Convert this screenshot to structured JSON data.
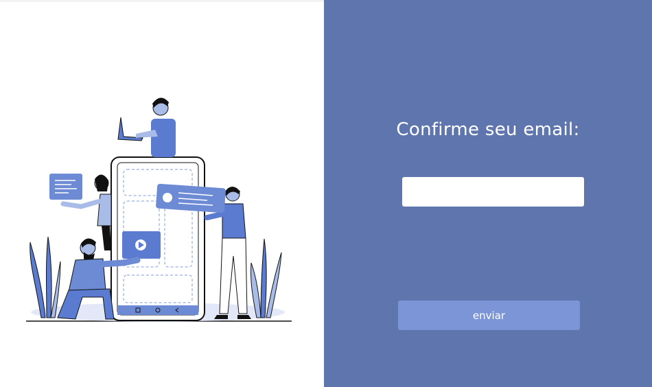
{
  "form": {
    "title": "Confirme seu email:",
    "email_value": "",
    "email_placeholder": "",
    "submit_label": "enviar"
  },
  "illustration": {
    "subject": "people-with-smartphone-illustration",
    "icons": [
      "laptop-icon",
      "message-card-icon",
      "video-play-icon",
      "profile-card-icon",
      "phone-nav-square-icon",
      "phone-nav-circle-icon",
      "phone-nav-back-icon"
    ]
  },
  "colors": {
    "panel_background": "#5e75ad",
    "button_background": "#7b95d6",
    "illustration_accent": "#5a7bd0",
    "illustration_light": "#a9bce8",
    "text_on_panel": "#ffffff"
  }
}
